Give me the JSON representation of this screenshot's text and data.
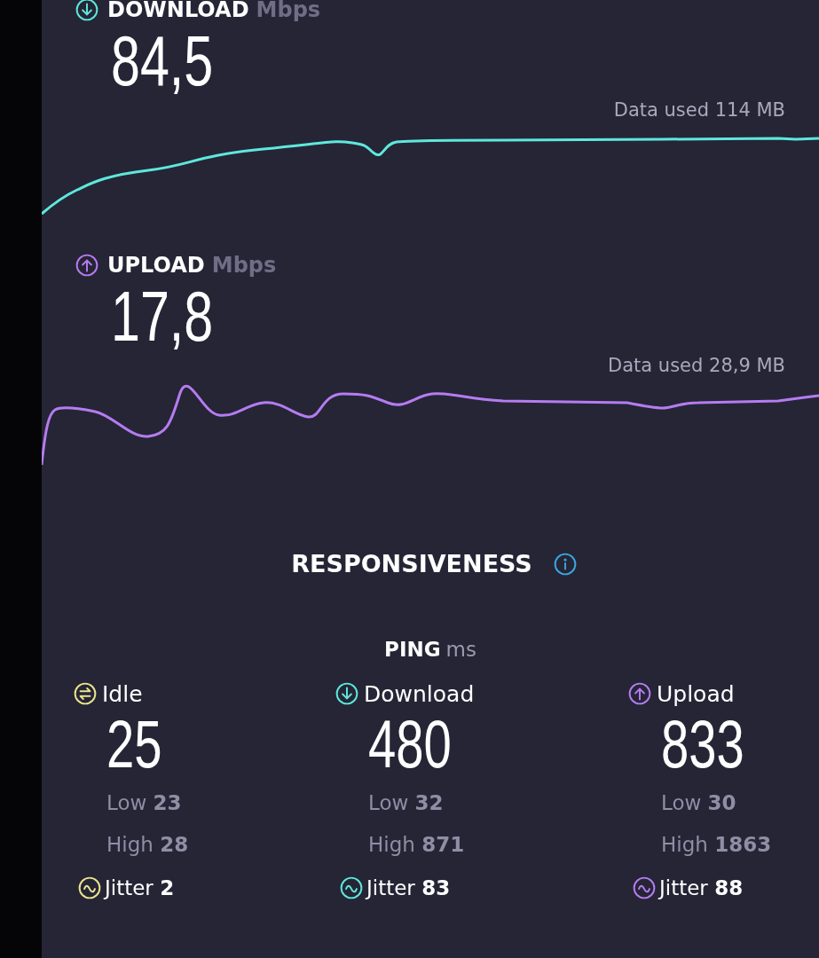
{
  "speeds": [
    {
      "kind": "download",
      "label": "DOWNLOAD",
      "unit": "Mbps",
      "value": "84,5",
      "data_used": "Data used 114 MB",
      "color": "#5ee8dc"
    },
    {
      "kind": "upload",
      "label": "UPLOAD",
      "unit": "Mbps",
      "value": "17,8",
      "data_used": "Data used 28,9 MB",
      "color": "#b57cf0"
    }
  ],
  "responsiveness": {
    "title": "RESPONSIVENESS"
  },
  "ping": {
    "label": "PING",
    "unit": "ms",
    "columns": [
      {
        "kind": "idle",
        "label": "Idle",
        "value": "25",
        "low_label": "Low",
        "low": "23",
        "high_label": "High",
        "high": "28",
        "jitter_label": "Jitter",
        "jitter": "2",
        "color": "#ece48e"
      },
      {
        "kind": "download",
        "label": "Download",
        "value": "480",
        "low_label": "Low",
        "low": "32",
        "high_label": "High",
        "high": "871",
        "jitter_label": "Jitter",
        "jitter": "83",
        "color": "#5ee8dc"
      },
      {
        "kind": "upload",
        "label": "Upload",
        "value": "833",
        "low_label": "Low",
        "low": "30",
        "high_label": "High",
        "high": "1863",
        "jitter_label": "Jitter",
        "jitter": "88",
        "color": "#b57cf0"
      }
    ]
  }
}
